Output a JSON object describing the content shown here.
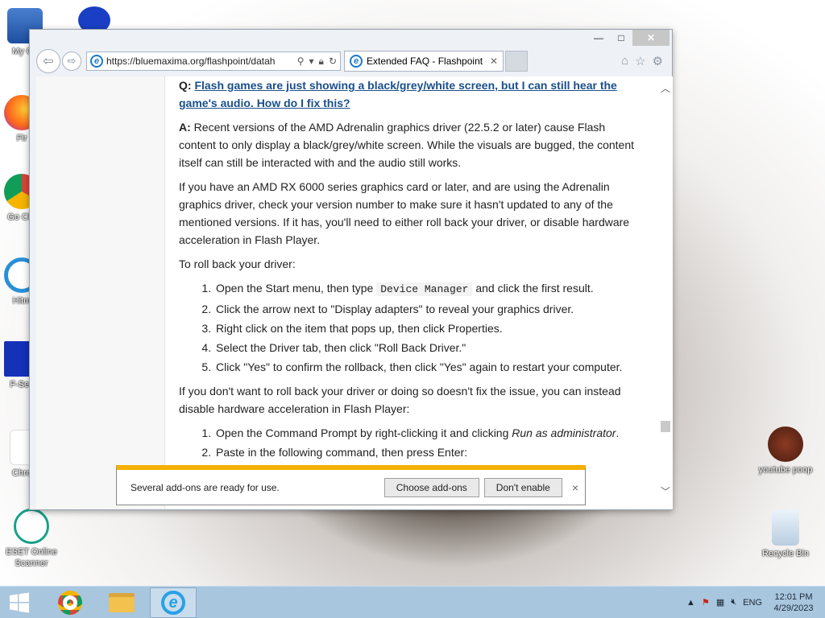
{
  "desktop": {
    "icons": [
      {
        "label": "My Co",
        "icon": "computer-icon"
      },
      {
        "label": "Fir",
        "icon": "firefox-icon"
      },
      {
        "label": "Go Chr",
        "icon": "chrome-icon"
      },
      {
        "label": "Hitm",
        "icon": "hitman-icon"
      },
      {
        "label": "F-Sec",
        "icon": "fsecure-icon"
      },
      {
        "label": "Chro",
        "icon": "chrome-shortcut-icon"
      },
      {
        "label": "ESET Online Scanner",
        "icon": "eset-icon"
      },
      {
        "label": "youtube poop",
        "icon": "youtube-icon"
      },
      {
        "label": "Recycle Bin",
        "icon": "recycle-bin-icon"
      }
    ]
  },
  "browser": {
    "address": "https://bluemaxima.org/flashpoint/datah",
    "tab_title": "Extended FAQ - Flashpoint ...",
    "window_controls": {
      "minimize": "—",
      "maximize": "□",
      "close": "✕"
    }
  },
  "article": {
    "q_label": "Q:",
    "question": "Flash games are just showing a black/grey/white screen, but I can still hear the game's audio. How do I fix this?",
    "a_label": "A:",
    "answer": "Recent versions of the AMD Adrenalin graphics driver (22.5.2 or later) cause Flash content to only display a black/grey/white screen. While the visuals are bugged, the content itself can still be interacted with and the audio still works.",
    "para2": "If you have an AMD RX 6000 series graphics card or later, and are using the Adrenalin graphics driver, check your version number to make sure it hasn't updated to any of the mentioned versions. If it has, you'll need to either roll back your driver, or disable hardware acceleration in Flash Player.",
    "rollback_intro": "To roll back your driver:",
    "rollback_steps": {
      "s1_pre": "Open the Start menu, then type",
      "s1_code": "Device Manager",
      "s1_post": "and click the first result.",
      "s2": "Click the arrow next to \"Display adapters\" to reveal your graphics driver.",
      "s3": "Right click on the item that pops up, then click Properties.",
      "s4": "Select the Driver tab, then click \"Roll Back Driver.\"",
      "s5": "Click \"Yes\" to confirm the rollback, then click \"Yes\" again to restart your computer."
    },
    "para3": "If you don't want to roll back your driver or doing so doesn't fix the issue, you can instead disable hardware acceleration in Flash Player:",
    "accel_steps": {
      "s1_pre": "Open the Command Prompt by right-clicking it and clicking",
      "s1_em": "Run as administrator",
      "s1_post": ".",
      "s2": "Paste in the following command, then press Enter:"
    }
  },
  "notification": {
    "message": "Several add-ons are ready for use.",
    "choose_label": "Choose add-ons",
    "dont_label": "Don't enable",
    "close": "×"
  },
  "taskbar": {
    "language": "ENG",
    "time": "12:01 PM",
    "date": "4/29/2023"
  },
  "colors": {
    "accent": "#f5b000",
    "link": "#1a4f8b",
    "taskbar": "#a9c6df"
  }
}
